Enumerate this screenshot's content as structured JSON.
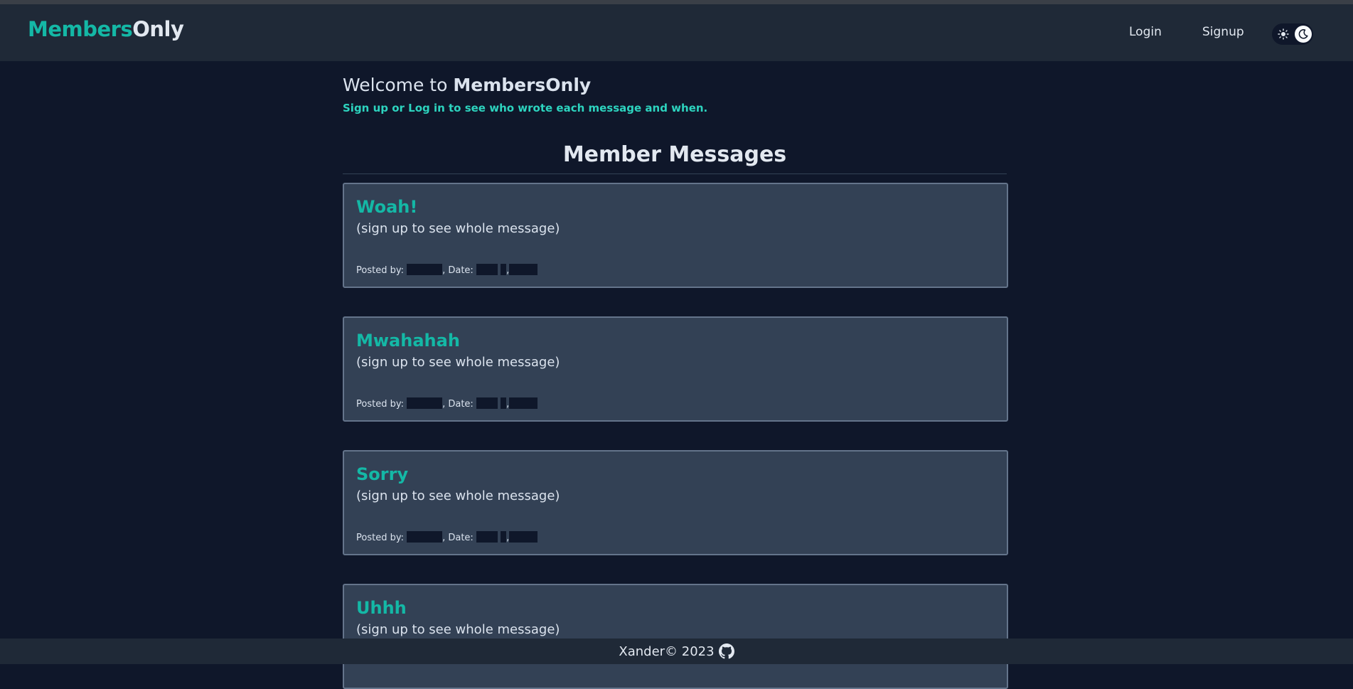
{
  "navbar": {
    "brand_part1": "Members",
    "brand_part2": "Only",
    "login_label": "Login",
    "signup_label": "Signup",
    "theme_toggle_icons": [
      "sun-icon",
      "moon-icon"
    ]
  },
  "hero": {
    "welcome_prefix": "Welcome to ",
    "welcome_brand": "MembersOnly",
    "subtitle": "Sign up or Log in to see who wrote each message and when."
  },
  "messages_section": {
    "title": "Member Messages",
    "posted_by_label": "Posted by: ",
    "date_label": ", Date: ",
    "date_separator": ",",
    "items": [
      {
        "title": "Woah!",
        "body": "(sign up to see whole message)"
      },
      {
        "title": "Mwahahah",
        "body": "(sign up to see whole message)"
      },
      {
        "title": "Sorry",
        "body": "(sign up to see whole message)"
      },
      {
        "title": "Uhhh",
        "body": "(sign up to see whole message)"
      }
    ]
  },
  "footer": {
    "text": "Xander© 2023",
    "icon": "github-icon"
  },
  "colors": {
    "background": "#0f172a",
    "navbar": "#1f2937",
    "accent": "#14b8a6",
    "card": "#334155"
  }
}
